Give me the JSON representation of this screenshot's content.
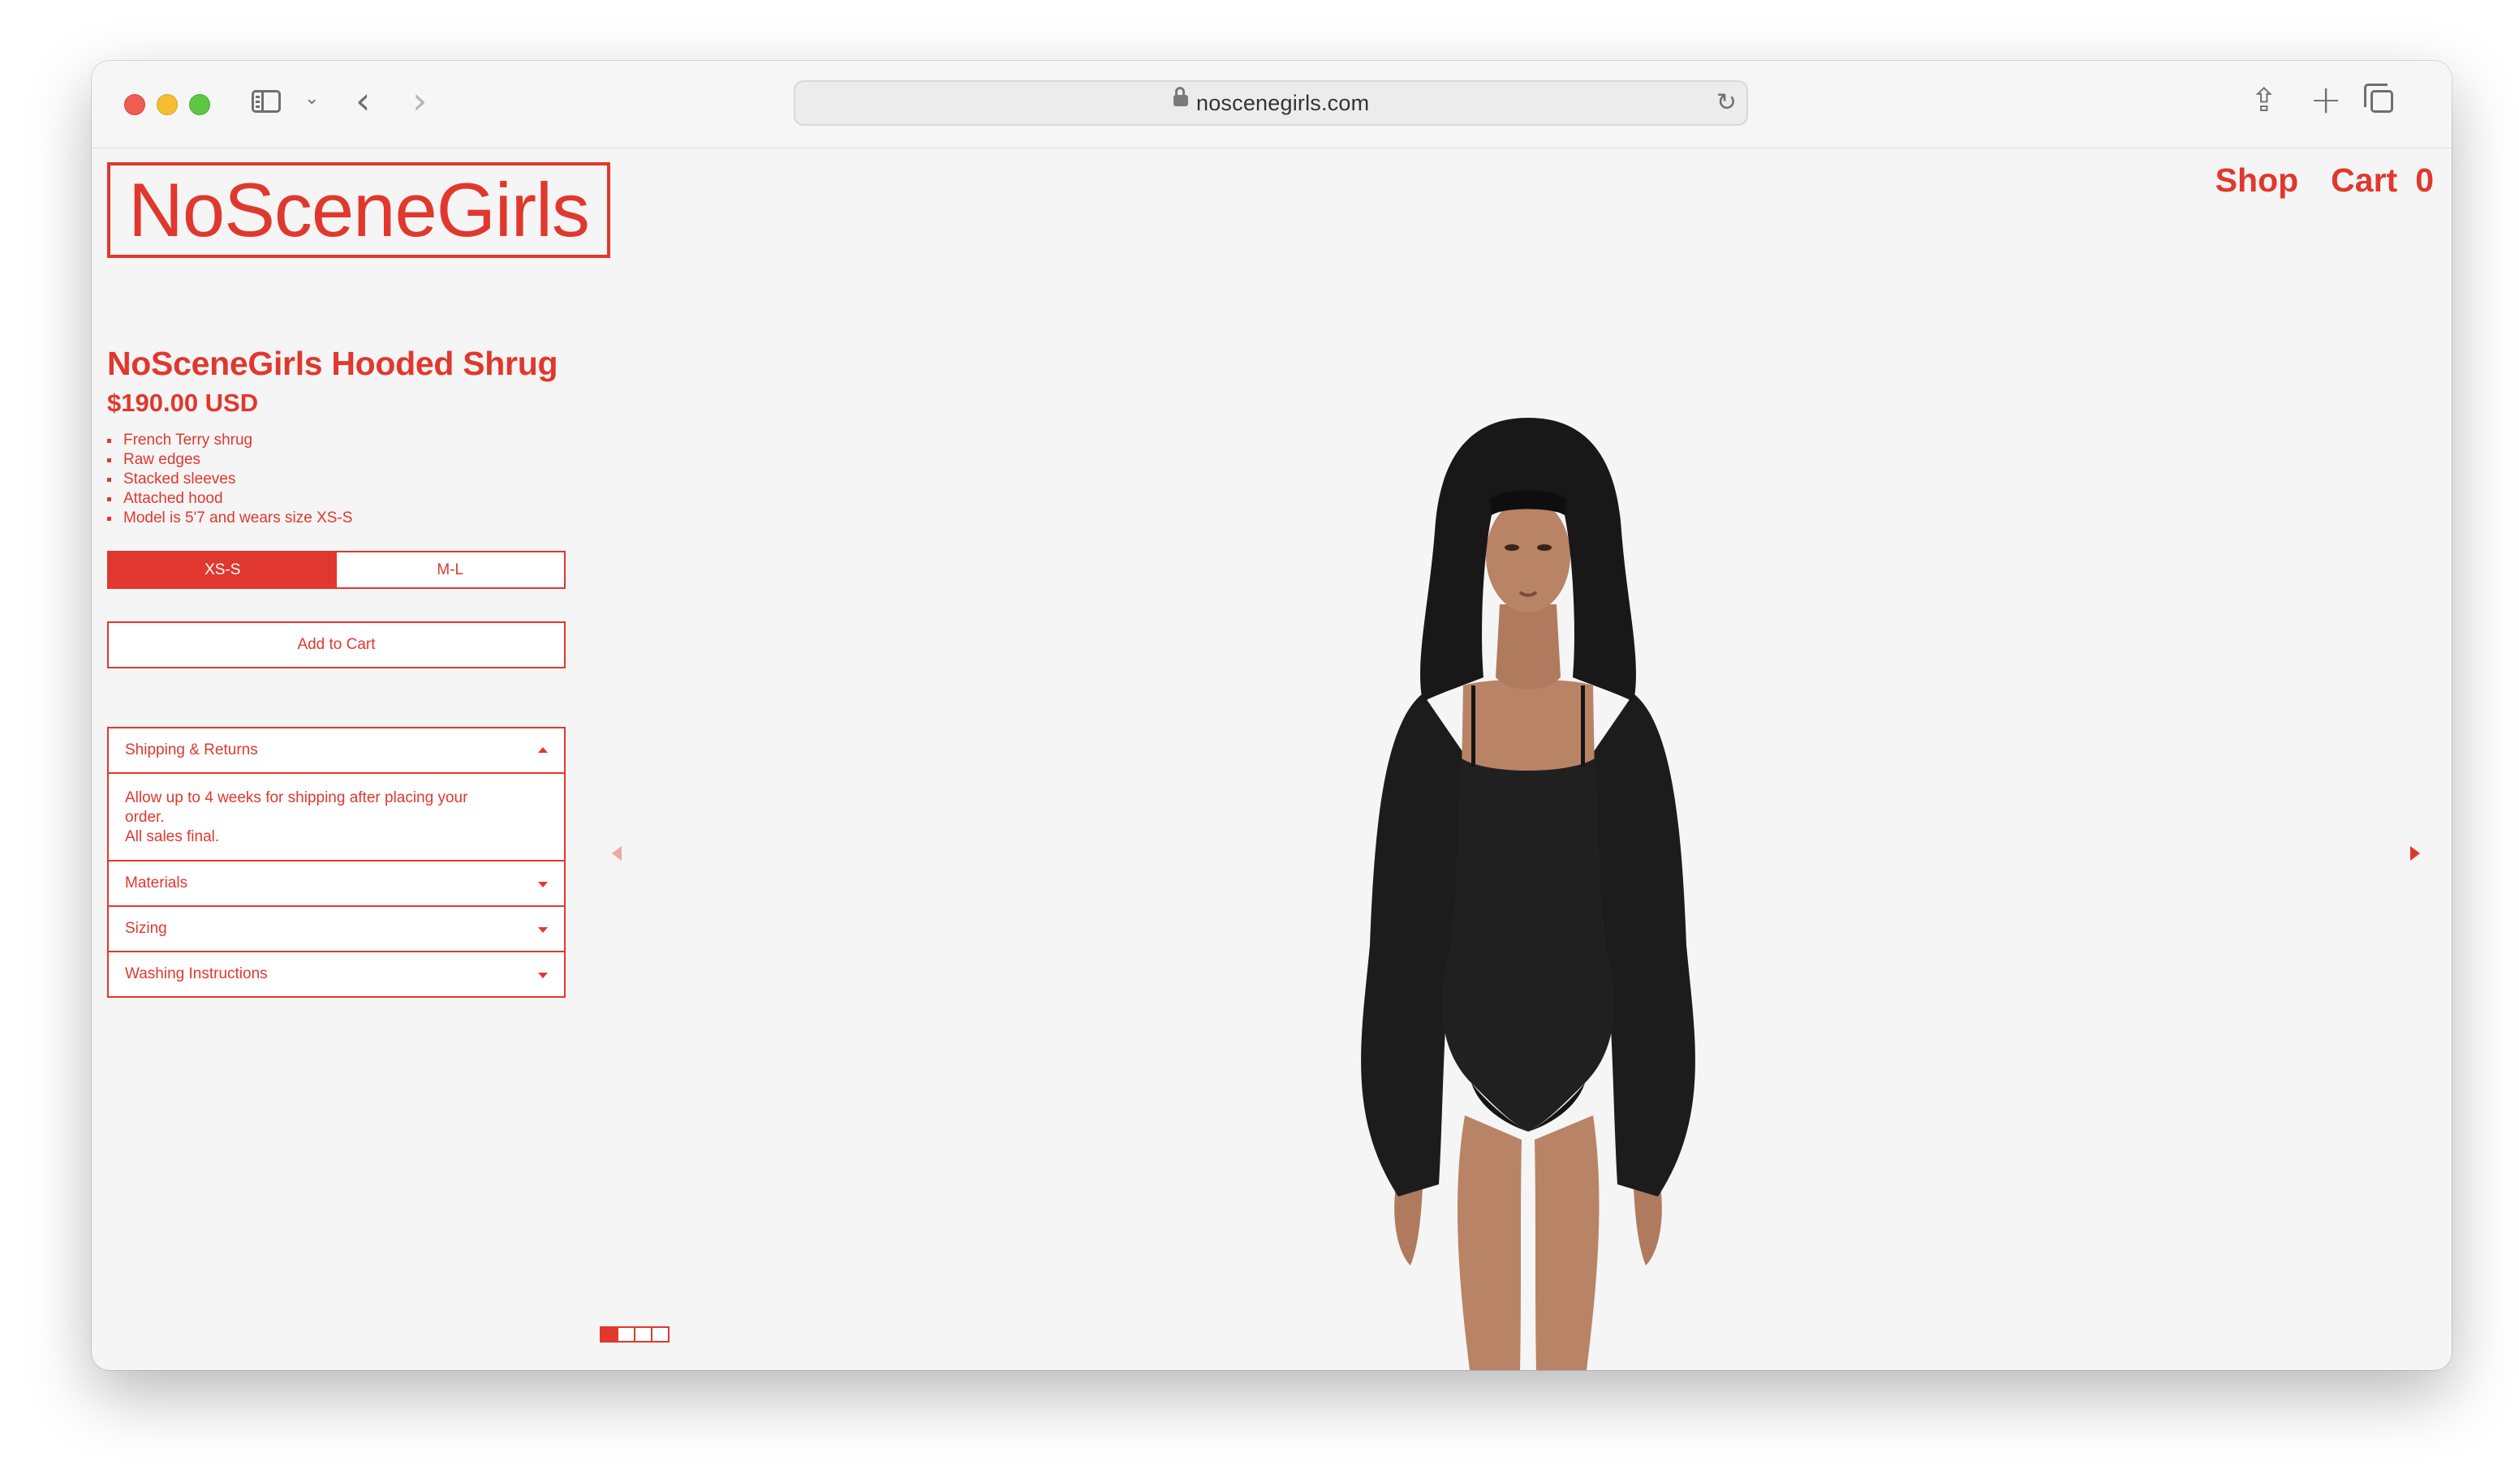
{
  "browser": {
    "url": "noscenegirls.com"
  },
  "site": {
    "logo": "NoSceneGirls",
    "nav": {
      "shop": "Shop",
      "cart_label": "Cart",
      "cart_count": "0"
    }
  },
  "product": {
    "title": "NoSceneGirls Hooded Shrug",
    "price": "$190.00 USD",
    "features": [
      "French Terry shrug",
      "Raw edges",
      "Stacked sleeves",
      "Attached hood",
      "Model is 5'7 and wears size XS-S"
    ],
    "sizes": [
      "XS-S",
      "M-L"
    ],
    "selected_size": "XS-S",
    "add_to_cart": "Add to Cart"
  },
  "accordion": [
    {
      "title": "Shipping & Returns",
      "expanded": true,
      "body": [
        "Allow up to 4 weeks for shipping after placing your order.",
        "All sales final."
      ]
    },
    {
      "title": "Materials",
      "expanded": false
    },
    {
      "title": "Sizing",
      "expanded": false
    },
    {
      "title": "Washing Instructions",
      "expanded": false
    }
  ],
  "carousel": {
    "slide_count": 4,
    "current_slide": 1
  },
  "colors": {
    "brand_red": "#e0382e",
    "page_bg": "#f4f5f4"
  }
}
